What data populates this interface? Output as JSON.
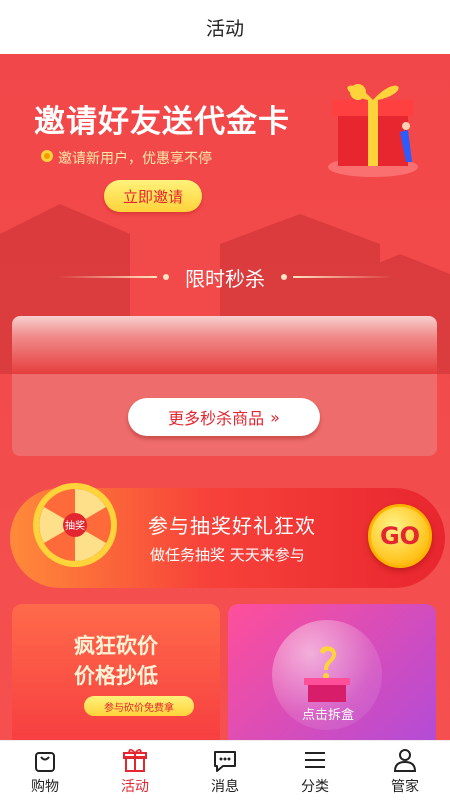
{
  "header": {
    "title": "活动"
  },
  "invite": {
    "headline": "邀请好友送代金卡",
    "subtitle": "邀请新用户，优惠享不停",
    "button_label": "立即邀请"
  },
  "flash_sale": {
    "title": "限时秒杀",
    "more_label": "更多秒杀商品",
    "more_chevron": "»"
  },
  "lottery": {
    "title": "参与抽奖好礼狂欢",
    "subtitle": "做任务抽奖 天天来参与",
    "go_label": "GO",
    "wheel_center": "抽奖"
  },
  "bargain": {
    "line1": "疯狂砍价",
    "line2": "价格抄低",
    "tag": "参与砍价免费拿"
  },
  "blind_box": {
    "label": "点击拆盒"
  },
  "tabbar": {
    "items": [
      {
        "label": "购物",
        "icon": "shopping-bag-icon"
      },
      {
        "label": "活动",
        "icon": "gift-icon"
      },
      {
        "label": "消息",
        "icon": "chat-icon"
      },
      {
        "label": "分类",
        "icon": "list-icon"
      },
      {
        "label": "管家",
        "icon": "user-icon"
      }
    ],
    "active_index": 1
  },
  "colors": {
    "accent": "#e3262f",
    "banner": "#f2474a",
    "gold": "#ffd33a"
  }
}
